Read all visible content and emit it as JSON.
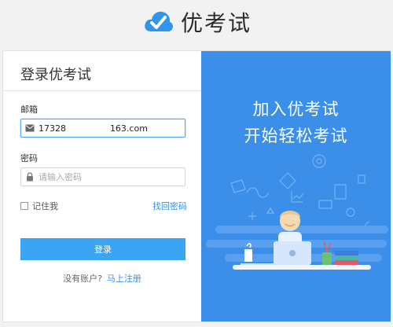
{
  "brand": {
    "name": "优考试",
    "logo_icon": "cloud-check-icon"
  },
  "login": {
    "title": "登录优考试",
    "email_label": "邮箱",
    "email_value": "17328                163.com",
    "password_label": "密码",
    "password_placeholder": "请输入密码",
    "remember_label": "记住我",
    "forgot_link": "找回密码",
    "submit_label": "登录",
    "no_account_text": "没有账户?",
    "register_link": "马上注册"
  },
  "promo": {
    "line1": "加入优考试",
    "line2": "开始轻松考试"
  },
  "colors": {
    "accent": "#3ca5f3",
    "promo_bg": "#3b8fe9",
    "link": "#3a8ee6"
  }
}
